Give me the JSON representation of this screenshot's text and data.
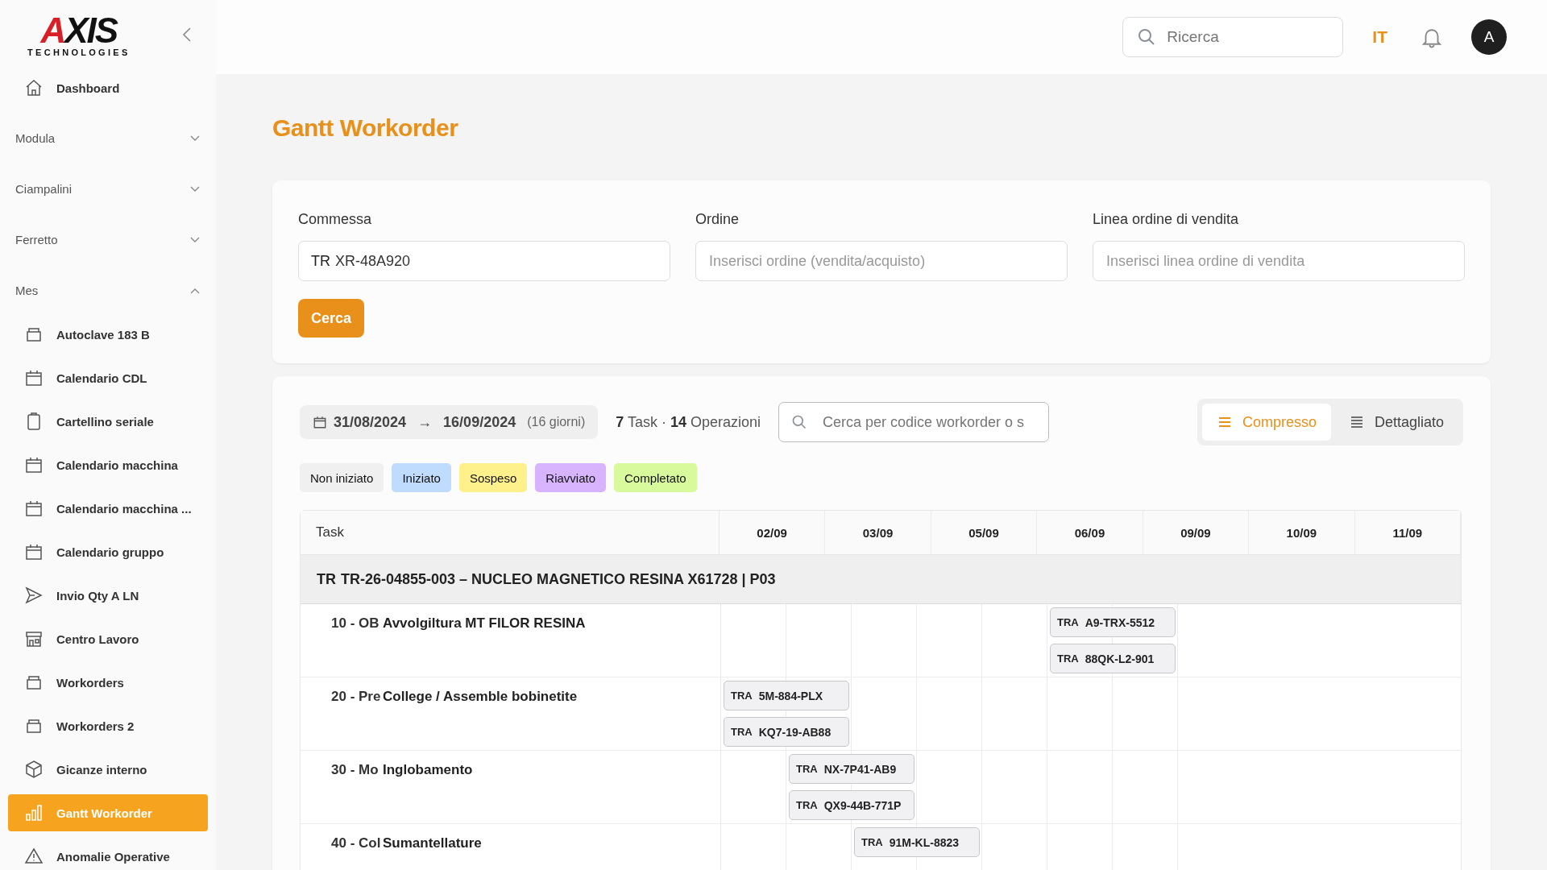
{
  "brand": {
    "name": "AXIS",
    "tagline": "TECHNOLOGIES"
  },
  "sidebar": {
    "items": [
      {
        "kind": "link",
        "label": "Dashboard",
        "selected": false
      },
      {
        "kind": "group",
        "label": "Modula",
        "expanded": false
      },
      {
        "kind": "group",
        "label": "Ciampalini",
        "expanded": false
      },
      {
        "kind": "group",
        "label": "Ferretto",
        "expanded": false
      },
      {
        "kind": "group",
        "label": "Mes",
        "expanded": true,
        "children": [
          {
            "label": "Autoclave 183 B",
            "selected": false
          },
          {
            "label": "Calendario CDL",
            "selected": false
          },
          {
            "label": "Cartellino seriale",
            "selected": false
          },
          {
            "label": "Calendario macchina",
            "selected": false
          },
          {
            "label": "Calendario macchina ...",
            "selected": false
          },
          {
            "label": "Calendario gruppo",
            "selected": false
          },
          {
            "label": "Invio Qty A LN",
            "selected": false
          },
          {
            "label": "Centro Lavoro",
            "selected": false
          },
          {
            "label": "Workorders",
            "selected": false
          },
          {
            "label": "Workorders 2",
            "selected": false
          },
          {
            "label": "Gicanze interno",
            "selected": false
          },
          {
            "label": "Gantt Workorder",
            "selected": true
          },
          {
            "label": "Anomalie Operative",
            "selected": false
          }
        ]
      }
    ]
  },
  "header": {
    "search": {
      "placeholder": "Ricerca"
    },
    "language": "IT",
    "avatar": "A"
  },
  "page_title": "Gantt Workorder",
  "filters": {
    "fields": [
      {
        "label": "Commessa",
        "prefix": "TR",
        "value": "XR-48A920"
      },
      {
        "label": "Ordine",
        "placeholder": "Inserisci ordine (vendita/acquisto)"
      },
      {
        "label": "Linea ordine di vendita",
        "placeholder": "Inserisci linea ordine di vendita"
      }
    ],
    "button": "Cerca"
  },
  "toolbar": {
    "date_from": "31/08/2024",
    "arrow": "→",
    "date_to": "16/09/2024",
    "days": "(16 giorni)",
    "task_count": "7",
    "task_word": "Task ·",
    "op_count": "14",
    "op_word": "Operazioni",
    "search": {
      "placeholder": "Cerca per codice workorder o s"
    },
    "views": [
      {
        "label": "Compresso",
        "selected": true
      },
      {
        "label": "Dettagliato",
        "selected": false
      }
    ]
  },
  "legend": [
    {
      "label": "Non iniziato",
      "color": "#f0f0f0"
    },
    {
      "label": "Iniziato",
      "color": "#bfdbfe"
    },
    {
      "label": "Sospeso",
      "color": "#fef08a"
    },
    {
      "label": "Riavviato",
      "color": "#d8b4fe"
    },
    {
      "label": "Completato",
      "color": "#d9f99d"
    }
  ],
  "gantt": {
    "task_header": "Task",
    "dates": [
      "02/09",
      "03/09",
      "05/09",
      "06/09",
      "09/09",
      "10/09",
      "11/09"
    ],
    "group": {
      "prefix": "TR",
      "title": "TR-26-04855-003 – NUCLEO MAGNETICO RESINA X61728 | P03"
    },
    "rows": [
      {
        "code": "10 - OB",
        "name": "Avvolgiltura MT FILOR RESINA",
        "slots": [
          false,
          false,
          false,
          false,
          false,
          true,
          false
        ],
        "bars": [
          {
            "prefix": "TRA",
            "code": "A9-TRX-5512"
          },
          {
            "prefix": "TRA",
            "code": "88QK-L2-901"
          }
        ]
      },
      {
        "code": "20 - Pre",
        "name": "College / Assemble bobinetite",
        "slots": [
          true,
          false,
          false,
          false,
          false,
          false,
          false
        ],
        "bars": [
          {
            "prefix": "TRA",
            "code": "5M-884-PLX"
          },
          {
            "prefix": "TRA",
            "code": "KQ7-19-AB88"
          }
        ]
      },
      {
        "code": "30 - Mo",
        "name": "Inglobamento",
        "slots": [
          false,
          true,
          false,
          false,
          false,
          false,
          false
        ],
        "bars": [
          {
            "prefix": "TRA",
            "code": "NX-7P41-AB9"
          },
          {
            "prefix": "TRA",
            "code": "QX9-44B-771P"
          }
        ]
      },
      {
        "code": "40 - Col",
        "name": "Sumantellature",
        "slots": [
          false,
          false,
          true,
          false,
          false,
          false,
          false
        ],
        "bars": [
          {
            "prefix": "TRA",
            "code": "91M-KL-8823"
          }
        ]
      }
    ]
  }
}
